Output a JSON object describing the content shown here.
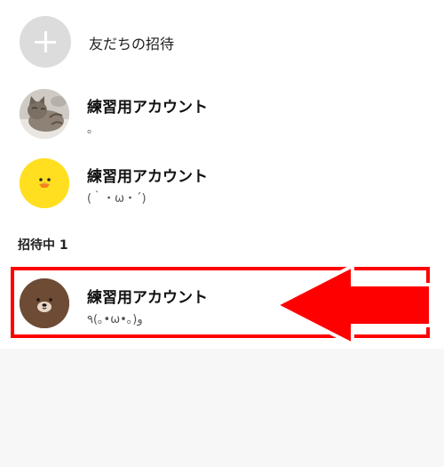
{
  "invite": {
    "label": "友だちの招待",
    "icon": "plus-icon"
  },
  "friends": [
    {
      "name": "練習用アカウント",
      "status": "。",
      "avatar": "cat-photo"
    },
    {
      "name": "練習用アカウント",
      "status": "(｀・ω・´)",
      "avatar": "yellow-chick"
    }
  ],
  "pending_section": {
    "header": "招待中 1"
  },
  "pending": [
    {
      "name": "練習用アカウント",
      "status": "٩(｡•ω•｡)و",
      "avatar": "brown-bear"
    }
  ],
  "annotation": {
    "color": "#ff0000"
  }
}
